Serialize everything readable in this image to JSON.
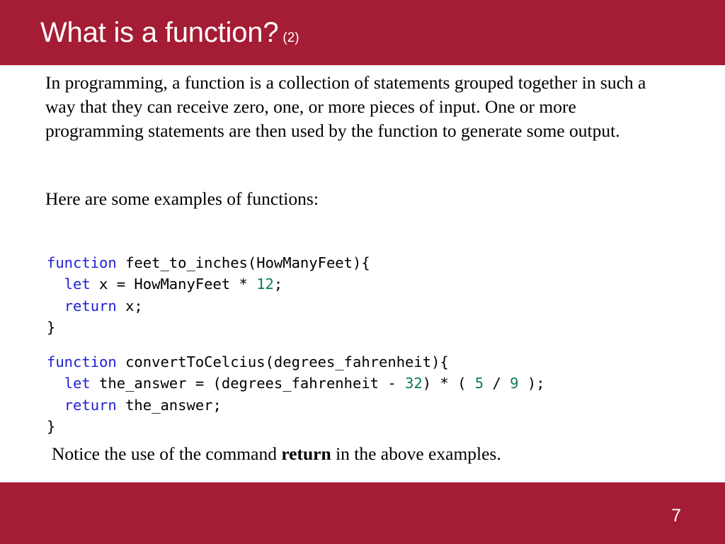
{
  "theme": {
    "accent_color": "#a51c35",
    "background_color": "#ffffff",
    "body_text_color": "#000000",
    "code_keyword_color": "#1f1fd6",
    "code_number_color": "#0b7a5c",
    "header_text_color": "#ffffff"
  },
  "header": {
    "title": "What is a function?",
    "title_suffix": "(2)"
  },
  "body": {
    "intro_paragraph": "In programming, a function is a collection of statements grouped together in such a way that they can receive zero, one, or more pieces of input.   One or more programming statements are then used by the function to generate some output.",
    "examples_lead_in": "Here are some examples of functions:",
    "notice_prefix": "Notice the use of the command ",
    "notice_emphasis": "return",
    "notice_suffix": " in the above examples."
  },
  "code_blocks": [
    {
      "name": "feet_to_inches",
      "lines": [
        [
          {
            "t": "function",
            "c": "kw"
          },
          {
            "t": " feet_to_inches(HowManyFeet){",
            "c": "plain"
          }
        ],
        [
          {
            "t": "  ",
            "c": "plain"
          },
          {
            "t": "let",
            "c": "kw"
          },
          {
            "t": " x = HowManyFeet * ",
            "c": "plain"
          },
          {
            "t": "12",
            "c": "num"
          },
          {
            "t": ";",
            "c": "plain"
          }
        ],
        [
          {
            "t": "  ",
            "c": "plain"
          },
          {
            "t": "return",
            "c": "kw"
          },
          {
            "t": " x;",
            "c": "plain"
          }
        ],
        [
          {
            "t": "}",
            "c": "plain"
          }
        ]
      ]
    },
    {
      "name": "convertToCelcius",
      "lines": [
        [
          {
            "t": "function",
            "c": "kw"
          },
          {
            "t": " convertToCelcius(degrees_fahrenheit){",
            "c": "plain"
          }
        ],
        [
          {
            "t": "  ",
            "c": "plain"
          },
          {
            "t": "let",
            "c": "kw"
          },
          {
            "t": " the_answer = (degrees_fahrenheit - ",
            "c": "plain"
          },
          {
            "t": "32",
            "c": "num"
          },
          {
            "t": ") * ( ",
            "c": "plain"
          },
          {
            "t": "5",
            "c": "num"
          },
          {
            "t": " / ",
            "c": "plain"
          },
          {
            "t": "9",
            "c": "num"
          },
          {
            "t": " );",
            "c": "plain"
          }
        ],
        [
          {
            "t": "  ",
            "c": "plain"
          },
          {
            "t": "return",
            "c": "kw"
          },
          {
            "t": " the_answer;",
            "c": "plain"
          }
        ],
        [
          {
            "t": "}",
            "c": "plain"
          }
        ]
      ]
    }
  ],
  "footer": {
    "page_number": "7"
  }
}
